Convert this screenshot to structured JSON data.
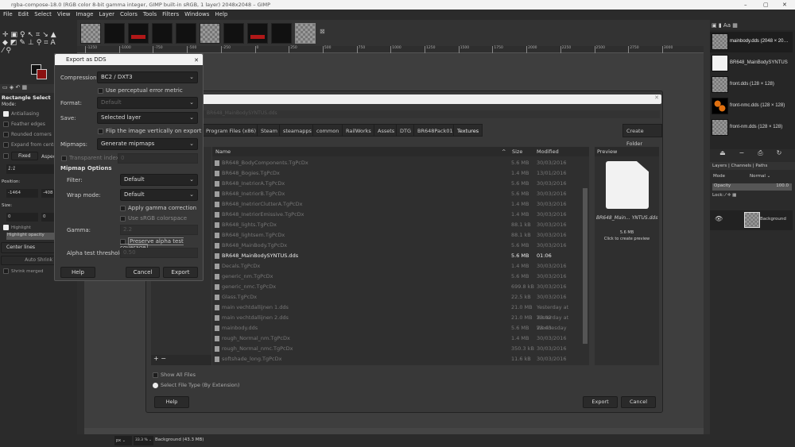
{
  "window": {
    "title": "rgba-compose-18.0 (RGB color 8-bit gamma integer, GIMP built-in sRGB, 1 layer) 2048x2048 – GIMP",
    "minimize": "–",
    "maximize": "▢",
    "close": "✕"
  },
  "menu": [
    "File",
    "Edit",
    "Select",
    "View",
    "Image",
    "Layer",
    "Colors",
    "Tools",
    "Filters",
    "Windows",
    "Help"
  ],
  "ruler": {
    "ticks": [
      "-1250",
      "-1000",
      "-750",
      "-500",
      "-250",
      "0",
      "250",
      "500",
      "750",
      "1000",
      "1250",
      "1500",
      "1750",
      "2000",
      "2250",
      "2500",
      "2750",
      "3000"
    ]
  },
  "tool_options": {
    "title": "Rectangle Select",
    "mode_label": "Mode:",
    "antialiasing": "Antialiasing",
    "feather": "Feather edges",
    "rounded": "Rounded corners",
    "expand": "Expand from center",
    "fixed": "Fixed",
    "aspect": "Aspect ratio",
    "ratio": "1:1",
    "position_label": "Position:",
    "pos_x": "-1464",
    "pos_y": "-408",
    "size_label": "Size:",
    "size_w": "0",
    "size_h": "0",
    "highlight": "Highlight",
    "highlight_opacity": "Highlight opacity",
    "guides": "Center lines",
    "auto_shrink": "Auto Shrink",
    "shrink_merged": "Shrink merged"
  },
  "dds": {
    "title": "Export as DDS",
    "close": "✕",
    "compression_label": "Compression:",
    "compression": "BC2 / DXT3",
    "perceptual": "Use perceptual error metric",
    "format_label": "Format:",
    "format": "Default",
    "save_label": "Save:",
    "save": "Selected layer",
    "flip": "Flip the image vertically on export",
    "mipmaps_label": "Mipmaps:",
    "mipmaps": "Generate mipmaps",
    "transparent_index": "Transparent index:",
    "transparent_value": "0",
    "mipmap_options": "Mipmap Options",
    "filter_label": "Filter:",
    "filter": "Default",
    "wrap_label": "Wrap mode:",
    "wrap": "Default",
    "gamma_correction": "Apply gamma correction",
    "srgb": "Use sRGB colorspace",
    "gamma_label": "Gamma:",
    "gamma": "2.2",
    "preserve_alpha": "Preserve alpha test coverage",
    "alpha_threshold_label": "Alpha test threshold:",
    "alpha_threshold": "0.50",
    "help": "Help",
    "cancel": "Cancel",
    "export": "Export"
  },
  "file_dialog": {
    "filename": "BR648_MainBodySYNTUS.dds",
    "breadcrumbs": [
      "Program Files (x86)",
      "Steam",
      "steamapps",
      "common",
      "RailWorks",
      "Assets",
      "DTG",
      "BR648Pack01",
      "Textures"
    ],
    "create_folder": "Create Folder",
    "columns": {
      "name": "Name",
      "size": "Size",
      "modified": "Modified"
    },
    "files": [
      {
        "name": "BR648_BodyComponents.TgPcDx",
        "size": "5.6 MB",
        "modified": "30/03/2016"
      },
      {
        "name": "BR648_Bogies.TgPcDx",
        "size": "1.4 MB",
        "modified": "13/01/2016"
      },
      {
        "name": "BR648_InetriorA.TgPcDx",
        "size": "5.6 MB",
        "modified": "30/03/2016"
      },
      {
        "name": "BR648_InetriorB.TgPcDx",
        "size": "5.6 MB",
        "modified": "30/03/2016"
      },
      {
        "name": "BR648_InetriorClutterA.TgPcDx",
        "size": "1.4 MB",
        "modified": "30/03/2016"
      },
      {
        "name": "BR648_InetriorEmissive.TgPcDx",
        "size": "1.4 MB",
        "modified": "30/03/2016"
      },
      {
        "name": "BR648_lights.TgPcDx",
        "size": "88.1 kB",
        "modified": "30/03/2016"
      },
      {
        "name": "BR648_lightsem.TgPcDx",
        "size": "88.1 kB",
        "modified": "30/03/2016"
      },
      {
        "name": "BR648_MainBody.TgPcDx",
        "size": "5.6 MB",
        "modified": "30/03/2016"
      },
      {
        "name": "BR648_MainBodySYNTUS.dds",
        "size": "5.6 MB",
        "modified": "01:06"
      },
      {
        "name": "Decals.TgPcDx",
        "size": "1.4 MB",
        "modified": "30/03/2016"
      },
      {
        "name": "generic_nm.TgPcDx",
        "size": "5.6 MB",
        "modified": "30/03/2016"
      },
      {
        "name": "generic_nmc.TgPcDx",
        "size": "699.8 kB",
        "modified": "30/03/2016"
      },
      {
        "name": "Glass.TgPcDx",
        "size": "22.5 kB",
        "modified": "30/03/2016"
      },
      {
        "name": "main vechtdallijnen 1.dds",
        "size": "21.0 MB",
        "modified": "Yesterday at 23:42"
      },
      {
        "name": "main vechtdallijnen 2.dds",
        "size": "21.0 MB",
        "modified": "Yesterday at 23:43"
      },
      {
        "name": "mainbody.dds",
        "size": "5.6 MB",
        "modified": "Wednesday"
      },
      {
        "name": "rough_Normal_nm.TgPcDx",
        "size": "1.4 MB",
        "modified": "30/03/2016"
      },
      {
        "name": "rough_Normal_nmc.TgPcDx",
        "size": "350.3 kB",
        "modified": "30/03/2016"
      },
      {
        "name": "softshade_long.TgPcDx",
        "size": "11.6 kB",
        "modified": "30/03/2016"
      }
    ],
    "preview_label": "Preview",
    "preview_name": "BR648_Main... YNTUS.dds",
    "preview_size": "5.6 MB",
    "preview_hint": "Click to create preview",
    "show_all": "Show All Files",
    "select_type": "Select File Type (By Extension)",
    "help": "Help",
    "export": "Export",
    "cancel": "Cancel",
    "add": "+",
    "remove": "−"
  },
  "images_panel": [
    "mainbody.dds (2048 × 20…",
    "BR648_MainBodySYNTUS",
    "front.dds (128 × 128)",
    "front-nmc.dds (128 × 128)",
    "front-nm.dds (128 × 128)"
  ],
  "layers": {
    "tabs": [
      "Layers",
      "Channels",
      "Paths"
    ],
    "mode_label": "Mode",
    "mode": "Normal",
    "opacity_label": "Opacity",
    "opacity": "100.0",
    "lock_label": "Lock:",
    "layer": "Background"
  },
  "status": {
    "unit": "px",
    "zoom": "33.3 %",
    "info": "Background (43.3 MB)"
  }
}
